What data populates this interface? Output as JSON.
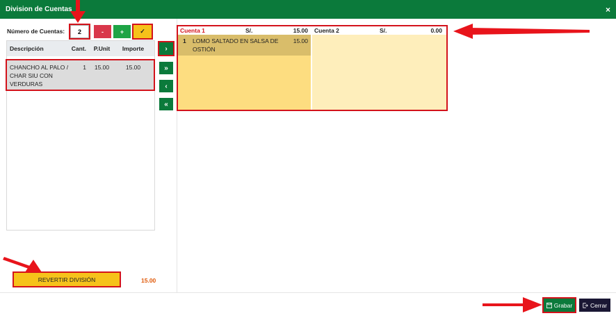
{
  "header": {
    "title": "Division de Cuentas",
    "close_label": "×"
  },
  "controls": {
    "count_label": "Número de Cuentas:",
    "count_value": "2",
    "minus_label": "-",
    "plus_label": "+",
    "check_label": "✓"
  },
  "left_table": {
    "columns": [
      "Descripción",
      "Cant.",
      "P.Unit",
      "Importe"
    ],
    "rows": [
      {
        "desc": "CHANCHO AL PALO / CHAR SIU CON VERDURAS",
        "qty": "1",
        "unit": "15.00",
        "total": "15.00"
      }
    ]
  },
  "move_buttons": {
    "one_right": "›",
    "all_right": "»",
    "one_left": "‹",
    "all_left": "«"
  },
  "accounts": [
    {
      "name": "Cuenta 1",
      "currency": "S/.",
      "total": "15.00",
      "items": [
        {
          "qty": "1",
          "desc": "LOMO SALTADO EN SALSA DE OSTIÓN",
          "price": "15.00"
        }
      ]
    },
    {
      "name": "Cuenta 2",
      "currency": "S/.",
      "total": "0.00",
      "items": []
    }
  ],
  "revert": {
    "label": "REVERTIR DIVISIÓN",
    "total": "15.00"
  },
  "footer": {
    "save_label": "Grabar",
    "close_label": "Cerrar"
  },
  "colors": {
    "header_green": "#0b7a3b",
    "highlight_red": "#d3121b",
    "yellow": "#f6c21a",
    "account1_bg": "#fddd80",
    "account2_bg": "#feeebb"
  },
  "icons": [
    "save-icon",
    "exit-icon",
    "close-icon"
  ]
}
